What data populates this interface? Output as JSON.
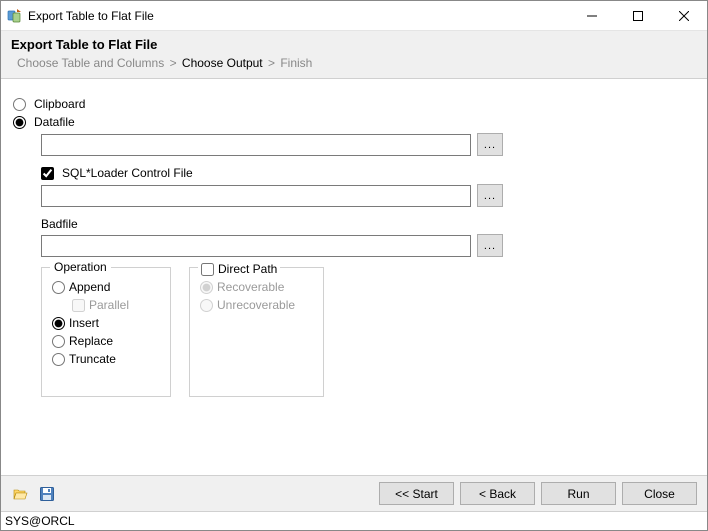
{
  "window": {
    "title": "Export Table to Flat File"
  },
  "header": {
    "heading": "Export Table to Flat File",
    "breadcrumb": {
      "step1": "Choose Table and Columns",
      "step2": "Choose Output",
      "step3": "Finish",
      "sep": ">"
    }
  },
  "options": {
    "clipboard_label": "Clipboard",
    "datafile_label": "Datafile",
    "selected": "datafile",
    "datafile_value": "",
    "sqlloader": {
      "checkbox_label": "SQL*Loader Control File",
      "checked": true,
      "value": ""
    },
    "badfile": {
      "label": "Badfile",
      "value": ""
    },
    "browse_label": "..."
  },
  "operation": {
    "legend": "Operation",
    "append": "Append",
    "parallel": "Parallel",
    "insert": "Insert",
    "replace": "Replace",
    "truncate": "Truncate",
    "selected": "insert",
    "parallel_checked": false
  },
  "directpath": {
    "checkbox_label": "Direct Path",
    "checked": false,
    "recoverable": "Recoverable",
    "unrecoverable": "Unrecoverable",
    "selected": "recoverable"
  },
  "footer": {
    "start": "<< Start",
    "back": "< Back",
    "run": "Run",
    "close": "Close"
  },
  "status": {
    "text": "SYS@ORCL"
  }
}
